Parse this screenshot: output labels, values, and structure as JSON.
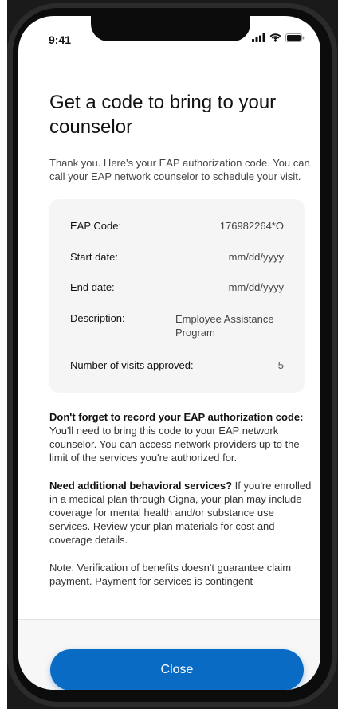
{
  "status_bar": {
    "time": "9:41",
    "icons": [
      "cellular-signal-icon",
      "wifi-icon",
      "battery-icon"
    ]
  },
  "page": {
    "title": "Get a code to bring to your counselor",
    "intro": "Thank you. Here's your EAP authorization code. You can call your EAP network counselor to schedule your visit."
  },
  "details": {
    "eap_code": {
      "label": "EAP Code:",
      "value": "176982264*O"
    },
    "start_date": {
      "label": "Start date:",
      "value": "mm/dd/yyyy"
    },
    "end_date": {
      "label": "End date:",
      "value": "mm/dd/yyyy"
    },
    "description": {
      "label": "Description:",
      "value": "Employee Assistance Program"
    },
    "visits": {
      "label": "Number of visits approved:",
      "value": "5"
    }
  },
  "reminder": {
    "bold": "Don't forget to record your EAP authorization code:",
    "text": " You'll need to bring this code to your EAP network counselor. You can access network providers up to the limit of the services you're authorized for."
  },
  "additional": {
    "bold": "Need additional behavioral services?",
    "text": " If you're enrolled in a medical plan through Cigna, your plan may include coverage for mental health and/or substance use services. Review your plan materials for cost and coverage details."
  },
  "note": {
    "text": "Note: Verification of benefits doesn't guarantee claim payment. Payment for services is contingent"
  },
  "actions": {
    "close_label": "Close"
  },
  "colors": {
    "primary": "#0a6bc5",
    "card_bg": "#f5f5f5",
    "text": "#111111"
  }
}
